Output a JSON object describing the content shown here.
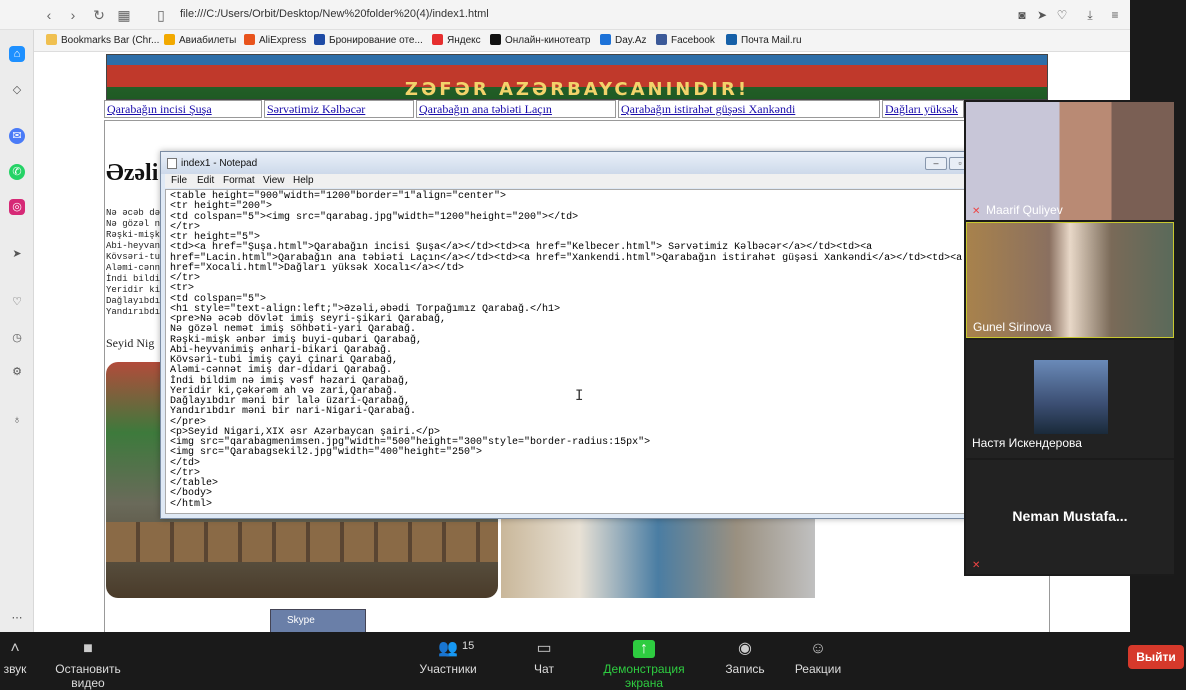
{
  "browser": {
    "url": "file:///C:/Users/Orbit/Desktop/New%20folder%20(4)/index1.html",
    "bookmarks": [
      {
        "label": "Bookmarks Bar (Chr...",
        "color": "#f0c050"
      },
      {
        "label": "Авиабилеты",
        "color": "#f2a900"
      },
      {
        "label": "AliExpress",
        "color": "#e8531c"
      },
      {
        "label": "Бронирование оте...",
        "color": "#1e4ba5"
      },
      {
        "label": "Яндекс",
        "color": "#e62e2e"
      },
      {
        "label": "Онлайн-кинотеатр",
        "color": "#111111"
      },
      {
        "label": "Day.Az",
        "color": "#1d72d8"
      },
      {
        "label": "Facebook",
        "color": "#3b5998"
      },
      {
        "label": "Почта Mail.ru",
        "color": "#1560a8"
      }
    ]
  },
  "page": {
    "banner_text": "ZƏFƏR AZƏRBAYCANINDIR!",
    "nav_links": [
      "Qarabağın incisi Şuşa",
      "Sərvətimiz Kəlbəcər",
      "Qarabağın ana təbiəti Laçın",
      "Qarabağın istirahət güşəsi Xankəndi",
      "Dağları yüksək"
    ],
    "heading": "Əzəli",
    "poem_fragments": [
      "Nə əcəb də",
      "Nə gözəl n",
      "Rəşki-mişk",
      "Abi-heyvan",
      "Kövsəri-tu",
      "Aləmi-cənn",
      "İndi bildi",
      "Yeridir ki",
      "Dağlayıbdı",
      "Yandırıbdı"
    ],
    "caption": "Seyid Nig",
    "skype_label": "Skype"
  },
  "notepad": {
    "title": "index1 - Notepad",
    "menu": [
      "File",
      "Edit",
      "Format",
      "View",
      "Help"
    ],
    "lines": [
      "<table height=\"900\"width=\"1200\"border=\"1\"align=\"center\">",
      "<tr height=\"200\">",
      "<td colspan=\"5\"><img src=\"qarabag.jpg\"width=\"1200\"height=\"200\"></td>",
      "</tr>",
      "<tr height=\"5\">",
      "<td><a href=\"Şuşa.html\">Qarabağın incisi Şuşa</a></td><td><a href=\"Kelbecer.html\"> Sərvətimiz Kəlbəcər</a></td><td><a",
      "href=\"Lacin.html\">Qarabağın ana təbiəti Laçın</a></td><td><a href=\"Xankendi.html\">Qarabağın istirahət güşəsi Xankəndi</a></td><td><a",
      "href=\"Xocali.html\">Dağları yüksək Xocalı</a></td>",
      "</tr>",
      "<tr>",
      "<td colspan=\"5\">",
      "<h1 style=\"text-align:left;\">Əzəli,əbədi Torpağımız Qarabağ.</h1>",
      "<pre>Nə əcəb dövlət imiş seyri-şikari Qarabağ,",
      "Nə gözəl nemət imiş söhbəti-yari Qarabağ.",
      "Rəşki-mişk ənbər imiş buyi-qubari Qarabağ,",
      "Abi-heyvanimiş ənhari-bikari Qarabağ.",
      "Kövsəri-tubi imiş çayi çinari Qarabağ,",
      "Aləmi-cənnət imiş dar-didari Qarabağ.",
      "İndi bildim nə imiş vəsf həzari Qarabağ,",
      "Yeridir ki,çəkərəm ah və zari,Qarabağ.",
      "Dağlayıbdır məni bir lalə üzari-Qarabağ,",
      "Yandırıbdır məni bir nari-Nigari-Qarabağ.",
      "</pre>",
      "<p>Seyid Nigari,XIX əsr Azərbaycan şairi.</p>",
      "<img src=\"qarabagmenimsen.jpg\"width=\"500\"height=\"300\"style=\"border-radius:15px\">",
      "<img src=\"Qarabagsekil2.jpg\"width=\"400\"height=\"250\">",
      "</td>",
      "</tr>",
      "</table>",
      "</body>",
      "</html>"
    ]
  },
  "participants": [
    {
      "name": "Maarif Quliyev",
      "muted": true
    },
    {
      "name": "Gunel Sirinova",
      "muted": false
    },
    {
      "name": "Настя Искендерова",
      "muted": false
    },
    {
      "name": "Neman  Mustafa...",
      "muted": true
    }
  ],
  "zoombar": {
    "audio": "звук",
    "stop_video": "Остановить видео",
    "participants": "Участники",
    "participants_count": "15",
    "chat": "Чат",
    "share": "Демонстрация экрана",
    "record": "Запись",
    "reactions": "Реакции",
    "leave": "Выйти",
    "share_color": "#2ecc40"
  }
}
